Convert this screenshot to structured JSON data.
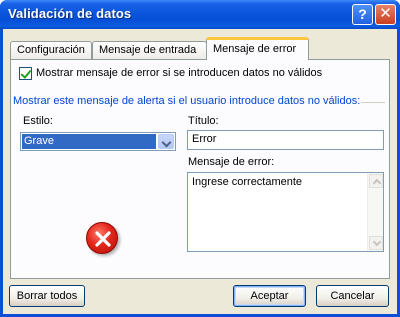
{
  "window": {
    "title": "Validación de datos",
    "help_glyph": "?",
    "close_glyph": "✕"
  },
  "tabs": [
    {
      "label": "Configuración"
    },
    {
      "label": "Mensaje de entrada"
    },
    {
      "label": "Mensaje de error",
      "selected": true
    }
  ],
  "panel": {
    "show_error_checkbox": {
      "label": "Mostrar mensaje de error si se introducen datos no válidos",
      "checked": true
    },
    "group_label": "Mostrar este mensaje de alerta si el usuario introduce datos no válidos:",
    "style": {
      "label": "Estilo:",
      "value": "Grave"
    },
    "title": {
      "label": "Título:",
      "value": "Error"
    },
    "error_message": {
      "label": "Mensaje de error:",
      "value": "Ingrese correctamente"
    },
    "icon": "error-icon"
  },
  "buttons": {
    "clear_all": "Borrar todos",
    "accept": "Aceptar",
    "cancel": "Cancelar"
  },
  "colors": {
    "titlebar": "#0a55db",
    "group_label": "#0046d5",
    "selection": "#316ac5",
    "dialog_bg": "#ece9d8"
  }
}
